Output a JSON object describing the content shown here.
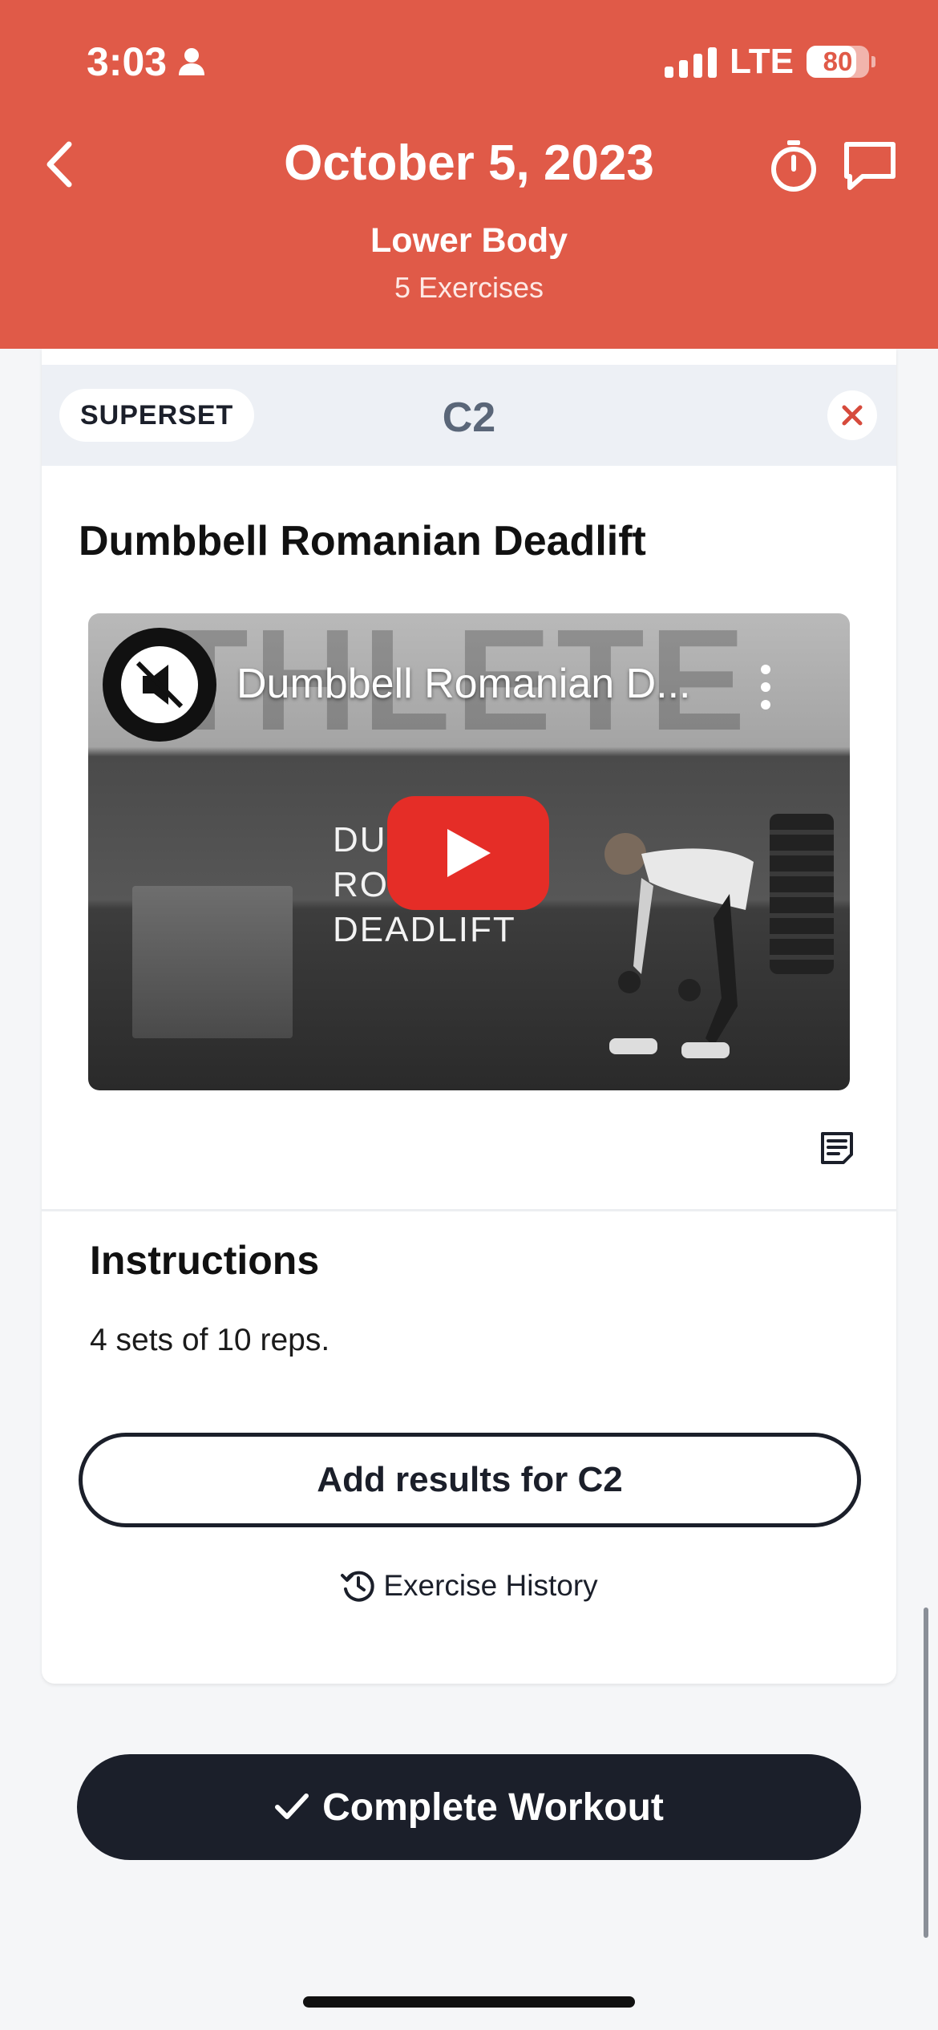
{
  "status_bar": {
    "time": "3:03",
    "network": "LTE",
    "battery": "80",
    "battery_level": 0.8
  },
  "header": {
    "title": "October 5, 2023",
    "workout_name": "Lower Body",
    "exercise_count": "5 Exercises"
  },
  "superset": {
    "badge": "SUPERSET",
    "id": "C2"
  },
  "exercise": {
    "title": "Dumbbell Romanian Deadlift",
    "video": {
      "title": "Dumbbell Romanian D...",
      "overlay_lines": [
        "DUM",
        "ROM",
        "DEADLIFT"
      ],
      "wall_text": "THLETE"
    }
  },
  "instructions": {
    "heading": "Instructions",
    "text": "4 sets of 10 reps."
  },
  "actions": {
    "add_results": "Add results for C2",
    "history": "Exercise History",
    "complete": "Complete Workout"
  },
  "colors": {
    "brand": "#e05a48",
    "dark": "#1b1f2a",
    "play": "#e52d27"
  }
}
